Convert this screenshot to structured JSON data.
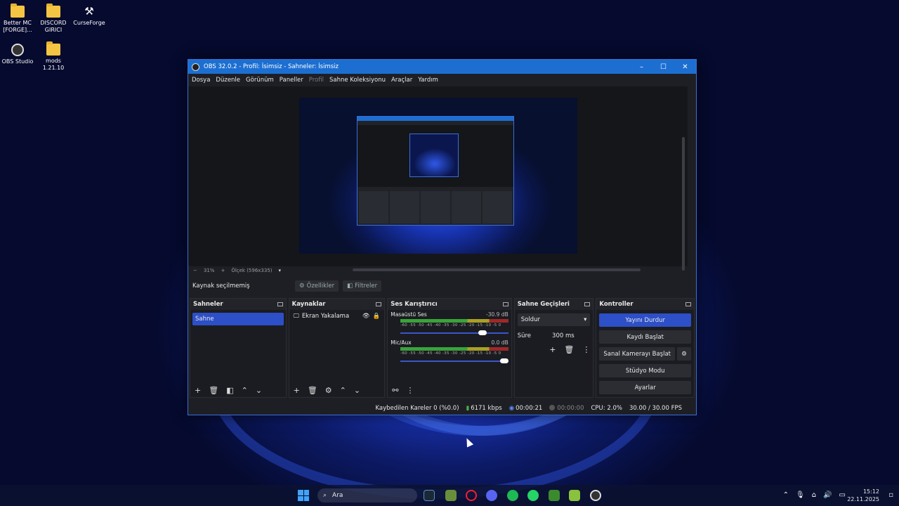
{
  "desktop": {
    "icons": [
      {
        "label": "Better MC [FORGE]...",
        "icon": "folder-icon"
      },
      {
        "label": "DISCORD GIRICI",
        "icon": "folder-icon"
      },
      {
        "label": "CurseForge",
        "icon": "curseforge-icon"
      },
      {
        "label": "OBS Studio",
        "icon": "obs-icon"
      },
      {
        "label": "mods 1.21.10",
        "icon": "folder-icon"
      }
    ]
  },
  "window": {
    "title": "OBS 32.0.2 - Profil: İsimsiz - Sahneler: İsimsiz",
    "minimize": "–",
    "maximize": "☐",
    "close": "✕"
  },
  "menu": {
    "items": [
      "Dosya",
      "Düzenle",
      "Görünüm",
      "Paneller",
      "Profil",
      "Sahne Koleksiyonu",
      "Araçlar",
      "Yardım"
    ]
  },
  "zoom": {
    "minus": "−",
    "level": "31%",
    "plus": "+",
    "scale_label": "Ölçek (596x335)"
  },
  "properties_bar": {
    "source_status": "Kaynak seçilmemiş",
    "properties_label": "Özellikler",
    "filters_label": "Filtreler"
  },
  "scenes": {
    "title": "Sahneler",
    "items": [
      "Sahne"
    ]
  },
  "sources": {
    "title": "Kaynaklar",
    "items": [
      "Ekran Yakalama"
    ]
  },
  "mixer": {
    "title": "Ses Karıştırıcı",
    "ticks": "-60 -55 -50 -45 -40 -35 -30 -25 -20 -15 -10 -5 0",
    "channels": [
      {
        "name": "Masaüstü Ses",
        "db": "-30.9 dB",
        "volume": 0.78
      },
      {
        "name": "Mic/Aux",
        "db": "0.0 dB",
        "volume": 1.0
      }
    ]
  },
  "transitions": {
    "title": "Sahne Geçişleri",
    "selected": "Soldur",
    "duration_label": "Süre",
    "duration_value": "300 ms"
  },
  "controls": {
    "title": "Kontroller",
    "stop_stream": "Yayını Durdur",
    "start_recording": "Kaydı Başlat",
    "virtual_camera": "Sanal Kamerayı Başlat",
    "studio_mode": "Stüdyo Modu",
    "settings": "Ayarlar"
  },
  "status": {
    "dropped_frames": "Kaybedilen Kareler 0 (%0.0)",
    "bitrate": "6171 kbps",
    "stream_time": "00:00:21",
    "record_time": "00:00:00",
    "cpu": "CPU: 2.0%",
    "fps": "30.00 / 30.00 FPS"
  },
  "taskbar": {
    "search_placeholder": "Ara",
    "time": "15:12",
    "date": "22.11.2025"
  },
  "colors": {
    "accent": "#2d4fc7",
    "titlebar": "#1c6fd1",
    "panel": "#1b1c21"
  }
}
